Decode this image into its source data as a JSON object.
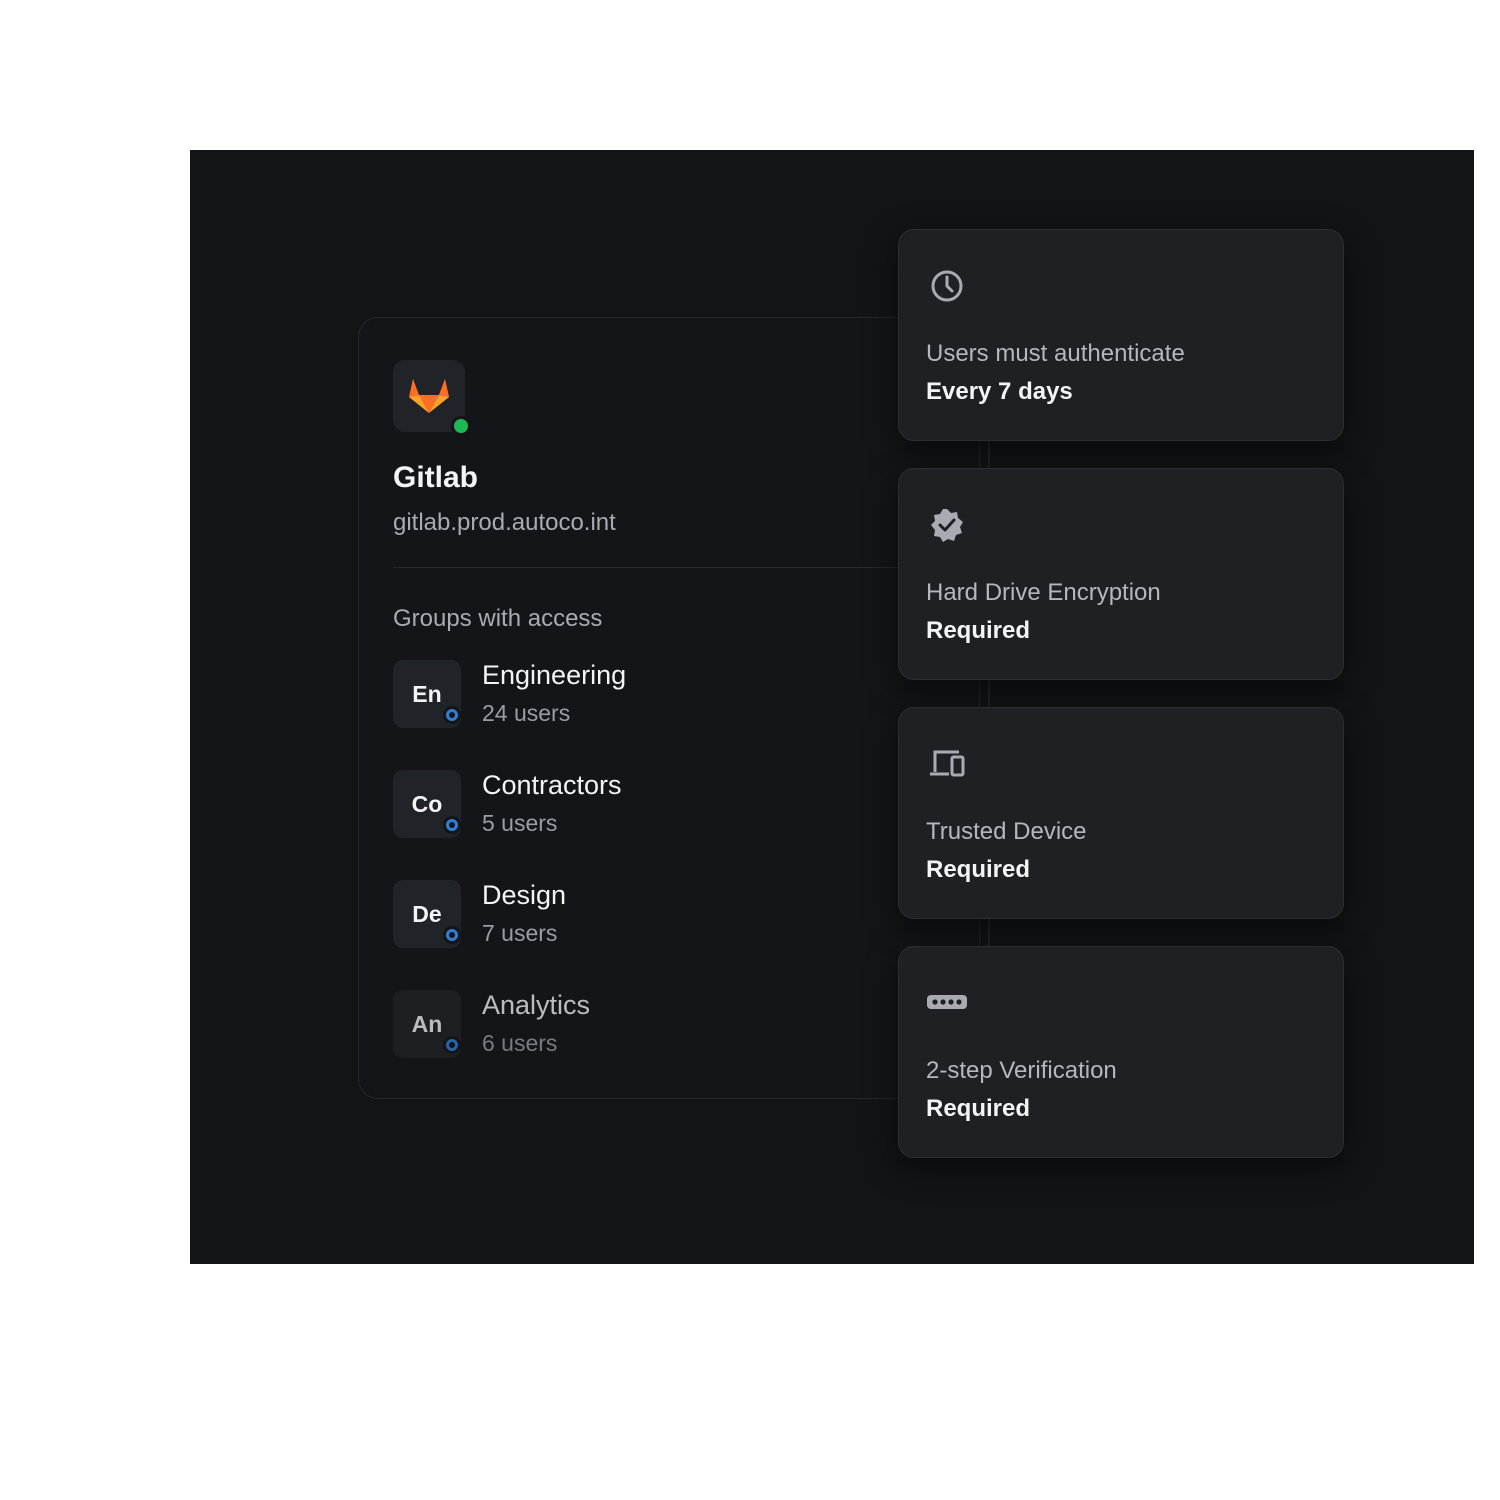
{
  "app": {
    "name": "Gitlab",
    "host": "gitlab.prod.autoco.int",
    "logo_icon": "gitlab-logo",
    "status": "online",
    "status_color": "#1db954"
  },
  "groups_section": {
    "title": "Groups with access",
    "groups": [
      {
        "initials": "En",
        "name": "Engineering",
        "users": "24 users"
      },
      {
        "initials": "Co",
        "name": "Contractors",
        "users": "5 users"
      },
      {
        "initials": "De",
        "name": "Design",
        "users": "7 users"
      },
      {
        "initials": "An",
        "name": "Analytics",
        "users": "6 users"
      }
    ]
  },
  "policies": [
    {
      "icon": "clock-icon",
      "label": "Users must authenticate",
      "value": "Every 7 days"
    },
    {
      "icon": "verified-badge-icon",
      "label": "Hard Drive Encryption",
      "value": "Required"
    },
    {
      "icon": "devices-icon",
      "label": "Trusted Device",
      "value": "Required"
    },
    {
      "icon": "password-dots-icon",
      "label": "2-step Verification",
      "value": "Required"
    }
  ],
  "colors": {
    "background": "#131416",
    "card": "#1e2023",
    "accent_blue": "#2f7fd6"
  }
}
